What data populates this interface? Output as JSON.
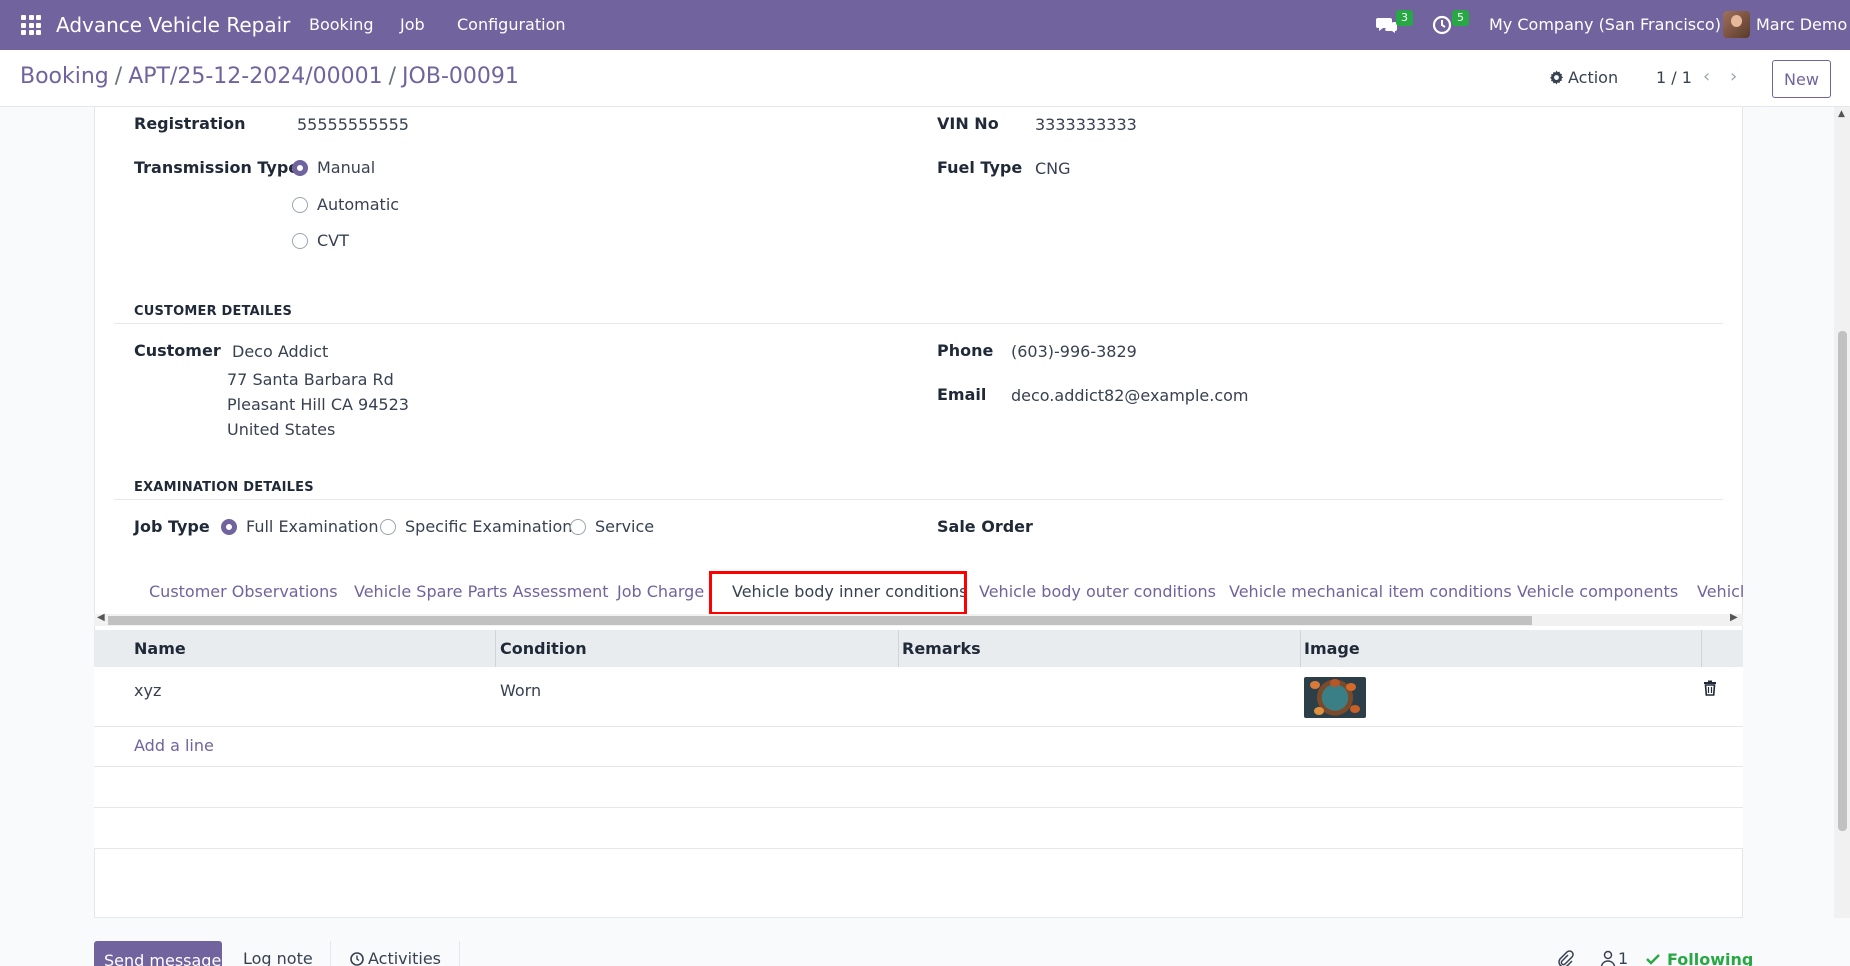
{
  "navbar": {
    "app_title": "Advance Vehicle Repair",
    "menu": [
      "Booking",
      "Job",
      "Configuration"
    ],
    "messages_count": "3",
    "activities_count": "5",
    "company": "My Company (San Francisco)",
    "user": "Marc Demo"
  },
  "control": {
    "breadcrumb": [
      "Booking",
      "APT/25-12-2024/00001",
      "JOB-00091"
    ],
    "action_label": "Action",
    "pager": "1 / 1",
    "new_label": "New"
  },
  "vehicle": {
    "registration_label": "Registration",
    "registration_value": "55555555555",
    "vin_label": "VIN No",
    "vin_value": "3333333333",
    "transmission_label": "Transmission Type",
    "transmission_options": [
      "Manual",
      "Automatic",
      "CVT"
    ],
    "transmission_selected": "Manual",
    "fuel_label": "Fuel Type",
    "fuel_value": "CNG"
  },
  "customer": {
    "section_title": "CUSTOMER DETAILES",
    "customer_label": "Customer",
    "name": "Deco Addict",
    "address_line1": "77 Santa Barbara Rd",
    "address_line2": "Pleasant Hill CA 94523",
    "address_line3": "United States",
    "phone_label": "Phone",
    "phone_value": "(603)-996-3829",
    "email_label": "Email",
    "email_value": "deco.addict82@example.com"
  },
  "examination": {
    "section_title": "EXAMINATION DETAILES",
    "job_type_label": "Job Type",
    "job_type_options": [
      "Full Examination",
      "Specific Examination",
      "Service"
    ],
    "job_type_selected": "Full Examination",
    "sale_order_label": "Sale Order"
  },
  "tabs": [
    "Customer Observations",
    "Vehicle Spare Parts Assessment",
    "Job Charge",
    "Vehicle body inner conditions",
    "Vehicle body outer conditions",
    "Vehicle mechanical item conditions",
    "Vehicle components",
    "Vehicl"
  ],
  "active_tab": "Vehicle body inner conditions",
  "table": {
    "columns": [
      "Name",
      "Condition",
      "Remarks",
      "Image"
    ],
    "rows": [
      {
        "name": "xyz",
        "condition": "Worn",
        "remarks": ""
      }
    ],
    "add_line": "Add a line"
  },
  "chatter": {
    "send_message": "Send message",
    "log_note": "Log note",
    "activities": "Activities",
    "followers_count": "1",
    "following": "Following"
  },
  "colors": {
    "brand": "#71639e",
    "highlight": "#ff0000",
    "success": "#28a745"
  }
}
